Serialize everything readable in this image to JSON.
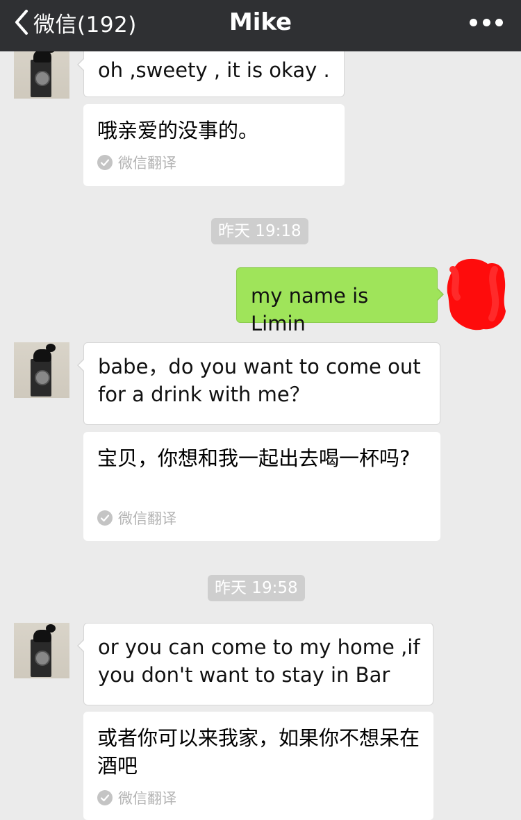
{
  "navbar": {
    "back_label": "微信(192)",
    "title": "Mike",
    "more_icon": "more-dots-icon"
  },
  "colors": {
    "navbar_bg": "#2f3033",
    "chat_bg": "#ebebeb",
    "sent_bubble": "#9fe45a",
    "timestamp_bg": "#cecece",
    "redaction": "#ff0000"
  },
  "messages": [
    {
      "id": "m1",
      "sender": "Mike",
      "direction": "incoming",
      "text": "oh ,sweety , it is okay .",
      "translation": "哦亲爱的没事的。",
      "translation_label": "微信翻译"
    },
    {
      "id": "t1",
      "type": "timestamp",
      "text": "昨天 19:18"
    },
    {
      "id": "m2",
      "direction": "outgoing",
      "text": "my name is Limin"
    },
    {
      "id": "m3",
      "sender": "Mike",
      "direction": "incoming",
      "text": "babe，do you want to come out for a drink with me？",
      "translation": "宝贝，你想和我一起出去喝一杯吗?",
      "translation_label": "微信翻译"
    },
    {
      "id": "t2",
      "type": "timestamp",
      "text": "昨天 19:58"
    },
    {
      "id": "m4",
      "sender": "Mike",
      "direction": "incoming",
      "text": "or you can come to my home ,if you don't want to stay in Bar",
      "translation": "或者你可以来我家，如果你不想呆在酒吧",
      "translation_label": "微信翻译"
    }
  ]
}
